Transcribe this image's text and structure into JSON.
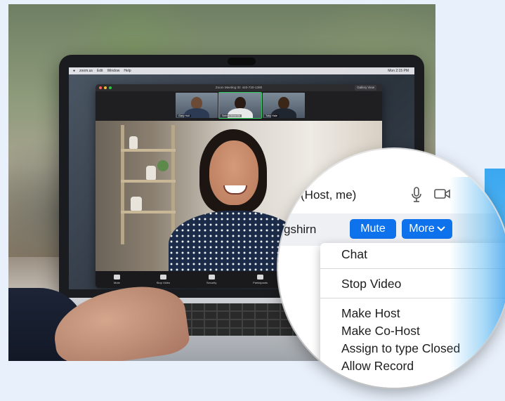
{
  "zoom_window": {
    "title": "Zoom Meeting ID: 440-720-1380",
    "gallery_label": "Gallery View",
    "thumbnails": [
      {
        "name": "Gary Hull"
      },
      {
        "name": "Selma Amanda"
      },
      {
        "name": "Toby Hale"
      }
    ],
    "toolbar": [
      {
        "label": "Mute",
        "icon": "mic-icon"
      },
      {
        "label": "Stop Video",
        "icon": "video-icon"
      },
      {
        "label": "Security",
        "icon": "shield-icon"
      },
      {
        "label": "Participants",
        "icon": "participants-icon"
      },
      {
        "label": "Chat",
        "icon": "chat-icon"
      },
      {
        "label": "Share Screen",
        "icon": "share-screen-icon"
      }
    ]
  },
  "mac_menubar": {
    "items": [
      "zoom.us",
      "Edit",
      "Window",
      "Help"
    ],
    "clock": "Mon 2:15 PM"
  },
  "participants_panel": {
    "host_label": "(Host, me)",
    "user_name_partial": "gshirn",
    "mute_button": "Mute",
    "more_button": "More"
  },
  "more_menu": {
    "items": [
      {
        "label": "Chat"
      },
      {
        "label": "Stop Video"
      },
      {
        "label": "Make Host"
      },
      {
        "label": "Make Co-Host"
      },
      {
        "label": "Assign to type Closed"
      },
      {
        "label": "Allow Record"
      }
    ]
  },
  "colors": {
    "accent_blue": "#0e72ed",
    "share_green": "#2fbf4f",
    "background": "#e8f0fb"
  }
}
